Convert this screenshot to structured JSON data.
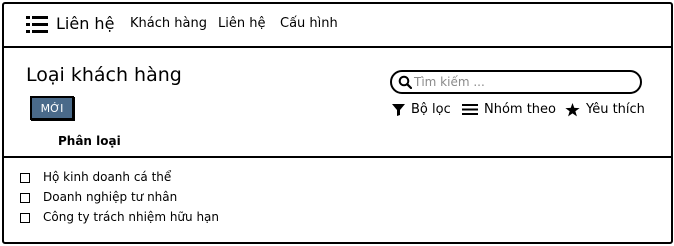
{
  "topbar": {
    "brand": "Liên hệ",
    "nav": [
      "Khách hàng",
      "Liên hệ",
      "Cấu hình"
    ]
  },
  "main": {
    "title": "Loại khách hàng",
    "new_button": "MỚI",
    "search_placeholder": "Tìm kiếm ...",
    "tools": {
      "filter": "Bộ lọc",
      "group_by": "Nhóm theo",
      "favorites": "Yêu thích"
    },
    "column_header": "Phân loại",
    "rows": [
      "Hộ kinh doanh cá thể",
      "Doanh nghiệp tư nhân",
      "Công ty trách nhiệm hữu hạn"
    ]
  },
  "colors": {
    "button": "#4a6a8a",
    "border": "#000000",
    "placeholder": "#8a8a8a"
  },
  "icons": [
    "hamburger-icon",
    "search-icon",
    "filter-icon",
    "group-by-icon",
    "star-icon"
  ]
}
